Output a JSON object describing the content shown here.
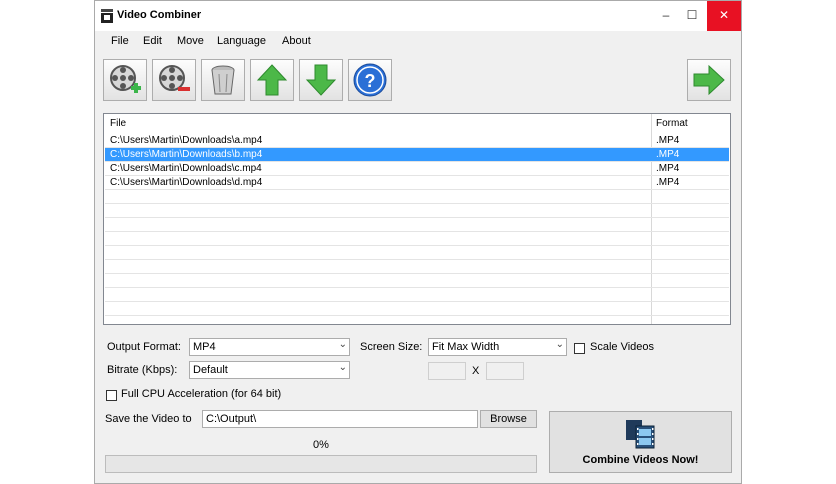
{
  "window": {
    "title": "Video Combiner"
  },
  "titlebar": {
    "minimize": "–",
    "maximize": "☐",
    "close": "✕"
  },
  "menu": [
    "File",
    "Edit",
    "Move",
    "Language",
    "About"
  ],
  "toolbar": {
    "buttons": [
      "add-video",
      "remove-video",
      "clear-list",
      "move-up",
      "move-down",
      "help"
    ],
    "start": "arrow-right"
  },
  "files": {
    "col_file": "File",
    "col_format": "Format",
    "rows": [
      {
        "path": "C:\\Users\\Martin\\Downloads\\a.mp4",
        "format": ".MP4"
      },
      {
        "path": "C:\\Users\\Martin\\Downloads\\b.mp4",
        "format": ".MP4",
        "selected": true
      },
      {
        "path": "C:\\Users\\Martin\\Downloads\\c.mp4",
        "format": ".MP4"
      },
      {
        "path": "C:\\Users\\Martin\\Downloads\\d.mp4",
        "format": ".MP4"
      }
    ]
  },
  "options": {
    "output_format_label": "Output Format:",
    "output_format_value": "MP4",
    "bitrate_label": "Bitrate (Kbps):",
    "bitrate_value": "Default",
    "screen_size_label": "Screen Size:",
    "screen_size_value": "Fit Max Width",
    "scale_videos_label": "Scale Videos",
    "size_x": "X",
    "full_cpu_label": "Full CPU Acceleration (for 64 bit)",
    "save_label": "Save the Video to",
    "save_path": "C:\\Output\\",
    "browse": "Browse",
    "progress_text": "0%",
    "progress": 0,
    "combine": "Combine Videos Now!"
  },
  "colors": {
    "selection": "#3399ff",
    "close": "#e81123",
    "arrow_green": "#4cb848",
    "help_blue": "#2a6fd6"
  }
}
